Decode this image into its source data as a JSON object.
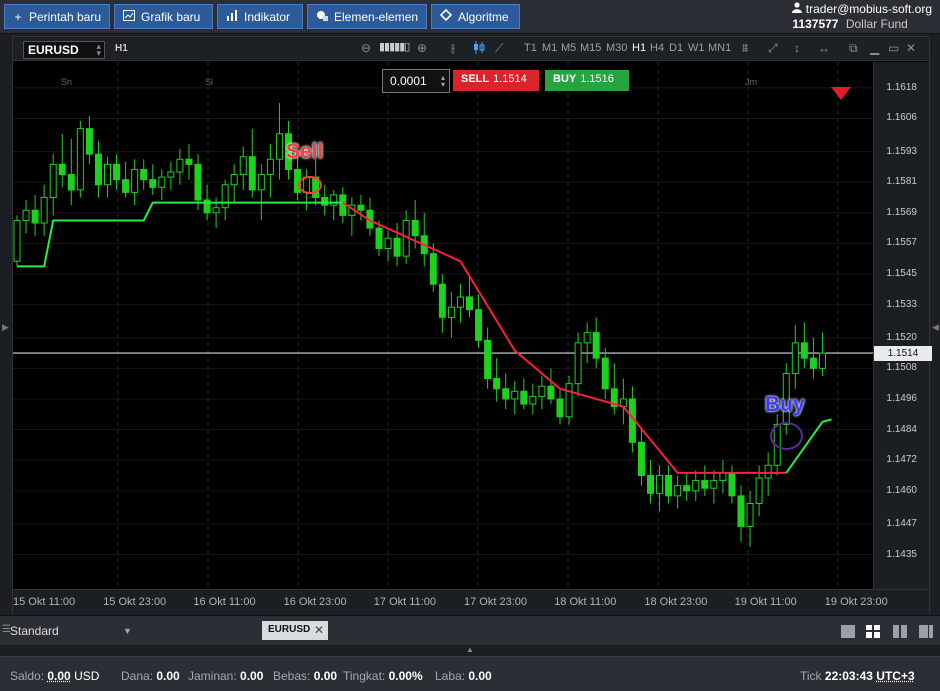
{
  "toolbar": {
    "new_order": "Perintah baru",
    "new_chart": "Grafik baru",
    "indicators": "Indikator",
    "elements": "Elemen-elemen",
    "algorithm": "Algoritme"
  },
  "account": {
    "email": "trader@mobius-soft.org",
    "id": "1137577",
    "fund": "Dollar Fund"
  },
  "chart": {
    "symbol": "EURUSD",
    "timeframe_label": "H1",
    "timeframes": [
      "T1",
      "M1",
      "M5",
      "M15",
      "M30",
      "H1",
      "H4",
      "D1",
      "W1",
      "MN1"
    ],
    "active_timeframe": "H1",
    "lot_value": "0.0001",
    "sell_label": "SELL",
    "sell_price": "1.1514",
    "buy_label": "BUY",
    "buy_price": "1.1516",
    "current_price": "1.1514",
    "annotation_sell": "Sell",
    "annotation_buy": "Buy",
    "day_labels": [
      "Sn",
      "Sl",
      "Jm"
    ],
    "price_labels": [
      "1.1618",
      "1.1606",
      "1.1593",
      "1.1581",
      "1.1569",
      "1.1557",
      "1.1545",
      "1.1533",
      "1.1520",
      "1.1508",
      "1.1496",
      "1.1484",
      "1.1472",
      "1.1460",
      "1.1447",
      "1.1435"
    ],
    "time_labels": [
      "15 Okt 11:00",
      "15 Okt 23:00",
      "16 Okt 11:00",
      "16 Okt 23:00",
      "17 Okt 11:00",
      "17 Okt 23:00",
      "18 Okt 11:00",
      "18 Okt 23:00",
      "19 Okt 11:00",
      "19 Okt 23:00"
    ],
    "colors": {
      "bull": "#1fd11f",
      "trend_up": "#22ee44",
      "trend_down": "#ff1e3c",
      "sell": "#d9242b",
      "buy": "#27a340"
    }
  },
  "chart_data": {
    "type": "candlestick",
    "symbol": "EURUSD",
    "timeframe": "H1",
    "ylim": [
      1.1425,
      1.1625
    ],
    "current_price": 1.1514,
    "candles": [
      [
        1.155,
        1.1568,
        1.1548,
        1.1566
      ],
      [
        1.1566,
        1.1574,
        1.1561,
        1.157
      ],
      [
        1.157,
        1.1576,
        1.156,
        1.1565
      ],
      [
        1.1565,
        1.158,
        1.156,
        1.1575
      ],
      [
        1.1575,
        1.1592,
        1.1568,
        1.1588
      ],
      [
        1.1588,
        1.16,
        1.1579,
        1.1584
      ],
      [
        1.1584,
        1.1598,
        1.1572,
        1.1578
      ],
      [
        1.1578,
        1.1605,
        1.1575,
        1.1602
      ],
      [
        1.1602,
        1.1607,
        1.1588,
        1.1592
      ],
      [
        1.1592,
        1.1597,
        1.1575,
        1.158
      ],
      [
        1.158,
        1.1591,
        1.1575,
        1.1588
      ],
      [
        1.1588,
        1.1592,
        1.1578,
        1.1582
      ],
      [
        1.1582,
        1.1589,
        1.1575,
        1.1577
      ],
      [
        1.1577,
        1.159,
        1.1572,
        1.1586
      ],
      [
        1.1586,
        1.159,
        1.1578,
        1.1582
      ],
      [
        1.1582,
        1.1588,
        1.1576,
        1.1579
      ],
      [
        1.1579,
        1.1586,
        1.1574,
        1.1583
      ],
      [
        1.1583,
        1.1589,
        1.1578,
        1.1585
      ],
      [
        1.1585,
        1.1594,
        1.158,
        1.159
      ],
      [
        1.159,
        1.1596,
        1.1582,
        1.1588
      ],
      [
        1.1588,
        1.1592,
        1.157,
        1.1574
      ],
      [
        1.1574,
        1.158,
        1.1566,
        1.1569
      ],
      [
        1.1569,
        1.1575,
        1.1563,
        1.1571
      ],
      [
        1.1571,
        1.1582,
        1.1566,
        1.158
      ],
      [
        1.158,
        1.1588,
        1.1573,
        1.1584
      ],
      [
        1.1584,
        1.1595,
        1.1578,
        1.1591
      ],
      [
        1.1591,
        1.1602,
        1.1575,
        1.1578
      ],
      [
        1.1578,
        1.1588,
        1.1566,
        1.1584
      ],
      [
        1.1584,
        1.1596,
        1.1575,
        1.159
      ],
      [
        1.159,
        1.1612,
        1.1582,
        1.16
      ],
      [
        1.16,
        1.1605,
        1.1582,
        1.1586
      ],
      [
        1.1586,
        1.1592,
        1.1574,
        1.1577
      ],
      [
        1.1577,
        1.1586,
        1.157,
        1.1583
      ],
      [
        1.1583,
        1.159,
        1.1572,
        1.1575
      ],
      [
        1.1575,
        1.158,
        1.1568,
        1.1572
      ],
      [
        1.1572,
        1.1578,
        1.1566,
        1.1576
      ],
      [
        1.1576,
        1.1579,
        1.1565,
        1.1568
      ],
      [
        1.1568,
        1.1575,
        1.156,
        1.1572
      ],
      [
        1.1572,
        1.1576,
        1.1566,
        1.157
      ],
      [
        1.157,
        1.1575,
        1.156,
        1.1563
      ],
      [
        1.1563,
        1.1566,
        1.1552,
        1.1555
      ],
      [
        1.1555,
        1.1562,
        1.155,
        1.1559
      ],
      [
        1.1559,
        1.1565,
        1.1548,
        1.1552
      ],
      [
        1.1552,
        1.157,
        1.1549,
        1.1566
      ],
      [
        1.1566,
        1.1574,
        1.1555,
        1.156
      ],
      [
        1.156,
        1.1569,
        1.1548,
        1.1553
      ],
      [
        1.1553,
        1.1557,
        1.1538,
        1.1541
      ],
      [
        1.1541,
        1.1545,
        1.1522,
        1.1528
      ],
      [
        1.1528,
        1.1538,
        1.152,
        1.1532
      ],
      [
        1.1532,
        1.1541,
        1.1526,
        1.1536
      ],
      [
        1.1536,
        1.1544,
        1.1528,
        1.1531
      ],
      [
        1.1531,
        1.1537,
        1.1516,
        1.1519
      ],
      [
        1.1519,
        1.1524,
        1.15,
        1.1504
      ],
      [
        1.1504,
        1.1512,
        1.1495,
        1.15
      ],
      [
        1.15,
        1.1506,
        1.1492,
        1.1496
      ],
      [
        1.1496,
        1.1503,
        1.149,
        1.1499
      ],
      [
        1.1499,
        1.1504,
        1.1492,
        1.1494
      ],
      [
        1.1494,
        1.1502,
        1.149,
        1.1497
      ],
      [
        1.1497,
        1.1505,
        1.1492,
        1.1501
      ],
      [
        1.1501,
        1.1508,
        1.1494,
        1.1496
      ],
      [
        1.1496,
        1.15,
        1.1486,
        1.1489
      ],
      [
        1.1489,
        1.1505,
        1.1486,
        1.1502
      ],
      [
        1.1502,
        1.1522,
        1.1497,
        1.1518
      ],
      [
        1.1518,
        1.1526,
        1.151,
        1.1522
      ],
      [
        1.1522,
        1.1528,
        1.1508,
        1.1512
      ],
      [
        1.1512,
        1.1516,
        1.1496,
        1.15
      ],
      [
        1.15,
        1.151,
        1.149,
        1.1493
      ],
      [
        1.1493,
        1.1504,
        1.1486,
        1.1496
      ],
      [
        1.1496,
        1.1501,
        1.1475,
        1.1479
      ],
      [
        1.1479,
        1.1484,
        1.1462,
        1.1466
      ],
      [
        1.1466,
        1.1472,
        1.1455,
        1.1459
      ],
      [
        1.1459,
        1.147,
        1.1452,
        1.1466
      ],
      [
        1.1466,
        1.147,
        1.1455,
        1.1458
      ],
      [
        1.1458,
        1.1466,
        1.1453,
        1.1462
      ],
      [
        1.1462,
        1.1467,
        1.1456,
        1.146
      ],
      [
        1.146,
        1.1468,
        1.1456,
        1.1464
      ],
      [
        1.1464,
        1.147,
        1.1458,
        1.1461
      ],
      [
        1.1461,
        1.1468,
        1.1455,
        1.1464
      ],
      [
        1.1464,
        1.1472,
        1.1459,
        1.1467
      ],
      [
        1.1467,
        1.147,
        1.1455,
        1.1458
      ],
      [
        1.1458,
        1.1462,
        1.144,
        1.1446
      ],
      [
        1.1446,
        1.146,
        1.1438,
        1.1455
      ],
      [
        1.1455,
        1.147,
        1.145,
        1.1465
      ],
      [
        1.1465,
        1.1475,
        1.1458,
        1.147
      ],
      [
        1.147,
        1.149,
        1.1466,
        1.1486
      ],
      [
        1.1486,
        1.151,
        1.1482,
        1.1506
      ],
      [
        1.1506,
        1.1525,
        1.15,
        1.1518
      ],
      [
        1.1518,
        1.1526,
        1.1508,
        1.1512
      ],
      [
        1.1512,
        1.152,
        1.1504,
        1.1508
      ],
      [
        1.1508,
        1.1522,
        1.1505,
        1.1514
      ]
    ],
    "trend_line": {
      "description": "Step trailing line, green when below price, red when above",
      "segments": [
        {
          "color": "trend_up",
          "points": [
            [
              0,
              1.1548
            ],
            [
              3,
              1.1548
            ],
            [
              4,
              1.1566
            ],
            [
              14,
              1.1566
            ],
            [
              15,
              1.1573
            ],
            [
              36,
              1.1573
            ]
          ]
        },
        {
          "color": "trend_down",
          "points": [
            [
              36,
              1.1573
            ],
            [
              39,
              1.1566
            ],
            [
              49,
              1.155
            ],
            [
              55,
              1.1515
            ],
            [
              60,
              1.15
            ],
            [
              64,
              1.1496
            ],
            [
              67,
              1.1493
            ],
            [
              73,
              1.1467
            ],
            [
              85,
              1.1467
            ]
          ]
        },
        {
          "color": "trend_up",
          "points": [
            [
              85,
              1.1467
            ],
            [
              89,
              1.1487
            ],
            [
              90,
              1.1488
            ]
          ]
        }
      ]
    },
    "annotations": [
      {
        "text": "Sell",
        "index": 35,
        "price": 1.1582,
        "color": "#ff3a3a"
      },
      {
        "text": "Buy",
        "index": 89,
        "price": 1.1482,
        "color": "#3a3aff"
      }
    ]
  },
  "bottom": {
    "workspace": "Standard",
    "tab_label": "EURUSD"
  },
  "status": {
    "saldo_label": "Saldo:",
    "saldo_value": "0.00",
    "saldo_currency": "USD",
    "dana_label": "Dana:",
    "dana_value": "0.00",
    "jaminan_label": "Jaminan:",
    "jaminan_value": "0.00",
    "bebas_label": "Bebas:",
    "bebas_value": "0.00",
    "tingkat_label": "Tingkat:",
    "tingkat_value": "0.00%",
    "laba_label": "Laba:",
    "laba_value": "0.00",
    "tick_label": "Tick",
    "tick_time": "22:03:43",
    "timezone": "UTC+3"
  }
}
